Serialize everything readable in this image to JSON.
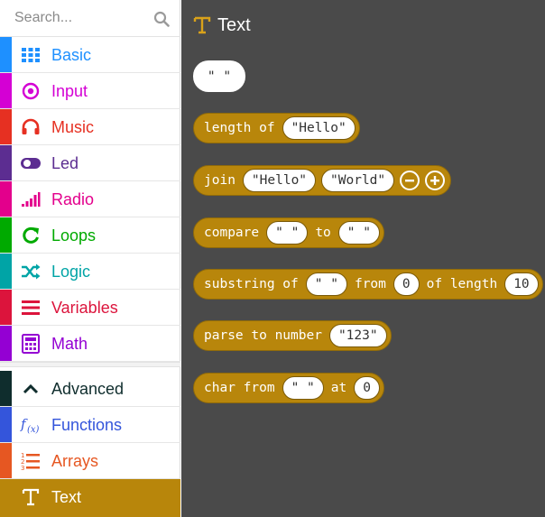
{
  "search": {
    "placeholder": "Search..."
  },
  "categories": [
    {
      "label": "Basic",
      "color": "#1e90ff",
      "icon": "grid-icon"
    },
    {
      "label": "Input",
      "color": "#d400d4",
      "icon": "target-icon"
    },
    {
      "label": "Music",
      "color": "#e63022",
      "icon": "headphones-icon"
    },
    {
      "label": "Led",
      "color": "#5c2d91",
      "icon": "toggle-icon"
    },
    {
      "label": "Radio",
      "color": "#e3008c",
      "icon": "signal-bars-icon"
    },
    {
      "label": "Loops",
      "color": "#00aa00",
      "icon": "refresh-icon"
    },
    {
      "label": "Logic",
      "color": "#00a4a6",
      "icon": "shuffle-icon"
    },
    {
      "label": "Variables",
      "color": "#dc143c",
      "icon": "list-lines-icon"
    },
    {
      "label": "Math",
      "color": "#9400d3",
      "icon": "calculator-icon"
    }
  ],
  "advanced": [
    {
      "label": "Advanced",
      "color": "#0f2d2d",
      "icon": "chevron-up-icon"
    },
    {
      "label": "Functions",
      "color": "#3455db",
      "icon": "function-icon"
    },
    {
      "label": "Arrays",
      "color": "#e65722",
      "icon": "numbered-list-icon"
    },
    {
      "label": "Text",
      "color": "#b8860b",
      "icon": "text-icon"
    }
  ],
  "flyout": {
    "title": "Text",
    "lone_string": "\" \"",
    "blocks": {
      "length": {
        "kw": "length of",
        "arg": "\"Hello\""
      },
      "join": {
        "kw": "join",
        "arg1": "\"Hello\"",
        "arg2": "\"World\""
      },
      "compare": {
        "kw": "compare",
        "arg1": "\" \"",
        "mid": "to",
        "arg2": "\" \""
      },
      "substring": {
        "kw": "substring of",
        "arg1": "\" \"",
        "mid1": "from",
        "arg2": "0",
        "mid2": "of length",
        "arg3": "10"
      },
      "parse": {
        "kw": "parse to number",
        "arg": "\"123\""
      },
      "charfrom": {
        "kw": "char from",
        "arg1": "\" \"",
        "mid": "at",
        "arg2": "0"
      }
    }
  }
}
